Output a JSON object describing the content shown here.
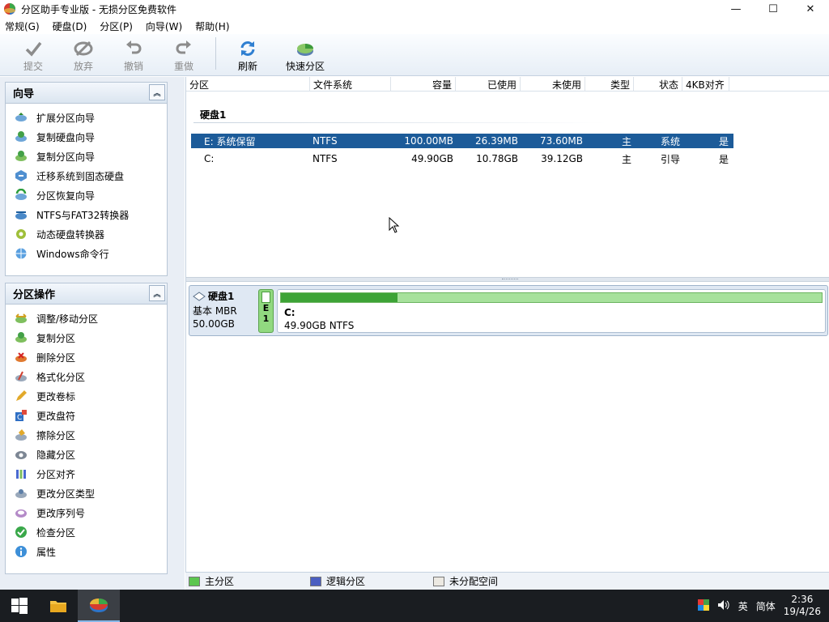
{
  "window": {
    "title": "分区助手专业版 - 无损分区免费软件",
    "controls": {
      "minimize": "—",
      "maximize": "☐",
      "close": "✕"
    }
  },
  "menu": [
    "常规(G)",
    "硬盘(D)",
    "分区(P)",
    "向导(W)",
    "帮助(H)"
  ],
  "toolbar": {
    "commit": "提交",
    "discard": "放弃",
    "undo": "撤销",
    "redo": "重做",
    "refresh": "刷新",
    "quick_partition": "快速分区"
  },
  "wizard_panel": {
    "title": "向导",
    "items": [
      "扩展分区向导",
      "复制硬盘向导",
      "复制分区向导",
      "迁移系统到固态硬盘",
      "分区恢复向导",
      "NTFS与FAT32转换器",
      "动态硬盘转换器",
      "Windows命令行"
    ]
  },
  "ops_panel": {
    "title": "分区操作",
    "items": [
      "调整/移动分区",
      "复制分区",
      "删除分区",
      "格式化分区",
      "更改卷标",
      "更改盘符",
      "擦除分区",
      "隐藏分区",
      "分区对齐",
      "更改分区类型",
      "更改序列号",
      "检查分区",
      "属性"
    ]
  },
  "table": {
    "columns": [
      "分区",
      "文件系统",
      "容量",
      "已使用",
      "未使用",
      "类型",
      "状态",
      "4KB对齐"
    ],
    "disk_label": "硬盘1",
    "rows": [
      {
        "partition": "E: 系统保留",
        "fs": "NTFS",
        "capacity": "100.00MB",
        "used": "26.39MB",
        "free": "73.60MB",
        "type": "主",
        "status": "系统",
        "aligned": "是",
        "selected": true
      },
      {
        "partition": "C:",
        "fs": "NTFS",
        "capacity": "49.90GB",
        "used": "10.78GB",
        "free": "39.12GB",
        "type": "主",
        "status": "引导",
        "aligned": "是",
        "selected": false
      }
    ]
  },
  "disk_map": {
    "disk_name": "硬盘1",
    "disk_type": "基本 MBR",
    "disk_size": "50.00GB",
    "part_e_letter": "E",
    "part_e_index": "1",
    "part_c_name": "C:",
    "part_c_info": "49.90GB NTFS",
    "part_c_used_fraction": 0.216
  },
  "legend": {
    "primary": "主分区",
    "logical": "逻辑分区",
    "unallocated": "未分配空间",
    "colors": {
      "primary": "#5cc64f",
      "logical": "#4b5fc1",
      "unallocated": "#ece9e2"
    }
  },
  "taskbar": {
    "ime": "英",
    "lang": "简体",
    "time": "2:36",
    "date": "19/4/26",
    "volume_icon": "speaker-icon"
  }
}
